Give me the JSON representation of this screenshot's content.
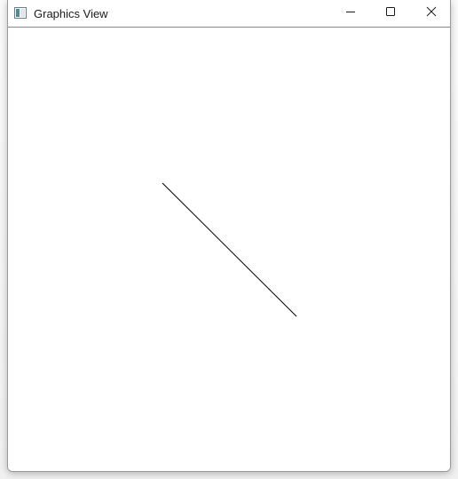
{
  "window": {
    "title": "Graphics View",
    "app_icon": "window-app-icon",
    "controls": {
      "minimize_icon": "minimize-icon",
      "maximize_icon": "maximize-icon",
      "close_icon": "close-icon"
    }
  },
  "scene": {
    "items": [
      {
        "type": "line",
        "color": "#000000"
      }
    ]
  }
}
